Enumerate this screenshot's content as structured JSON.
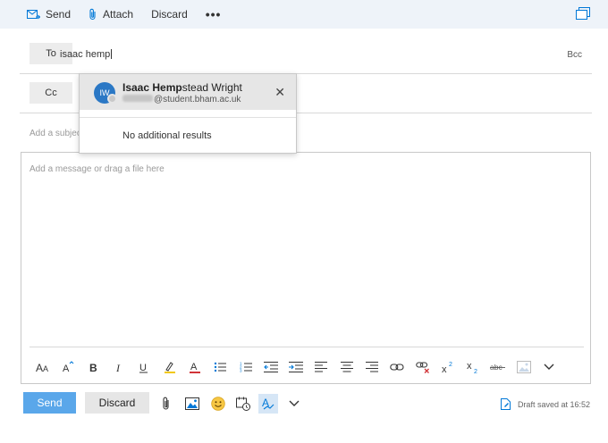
{
  "toolbar": {
    "send_label": "Send",
    "attach_label": "Attach",
    "discard_label": "Discard",
    "more_label": "•••"
  },
  "to_row": {
    "label": "To",
    "value": "isaac hemp",
    "bcc_label": "Bcc"
  },
  "cc_row": {
    "label": "Cc"
  },
  "subject": {
    "placeholder": "Add a subject"
  },
  "suggestions": {
    "items": [
      {
        "initials": "IW",
        "name_match": "Isaac Hemp",
        "name_rest": "stead Wright",
        "email_domain": "@student.bham.ac.uk"
      }
    ],
    "no_results": "No additional results"
  },
  "body": {
    "placeholder": "Add a message or drag a file here"
  },
  "formatting": {
    "tools": [
      "font-size-icon",
      "grow-font-icon",
      "bold-icon",
      "italic-icon",
      "underline-icon",
      "highlight-icon",
      "font-color-icon",
      "bullets-icon",
      "numbering-icon",
      "decrease-indent-icon",
      "increase-indent-icon",
      "align-left-icon",
      "align-center-icon",
      "align-right-icon",
      "insert-link-icon",
      "remove-link-icon",
      "superscript-icon",
      "subscript-icon",
      "strikethrough-icon",
      "insert-picture-icon",
      "more-formatting-icon"
    ],
    "strikethrough_label": "abc"
  },
  "footer": {
    "send_label": "Send",
    "discard_label": "Discard",
    "draft_status": "Draft saved at 16:52"
  },
  "colors": {
    "accent": "#0078d7",
    "send_button": "#5aa7ea",
    "command_bar": "#eef3f9",
    "avatar": "#2b78c5"
  }
}
